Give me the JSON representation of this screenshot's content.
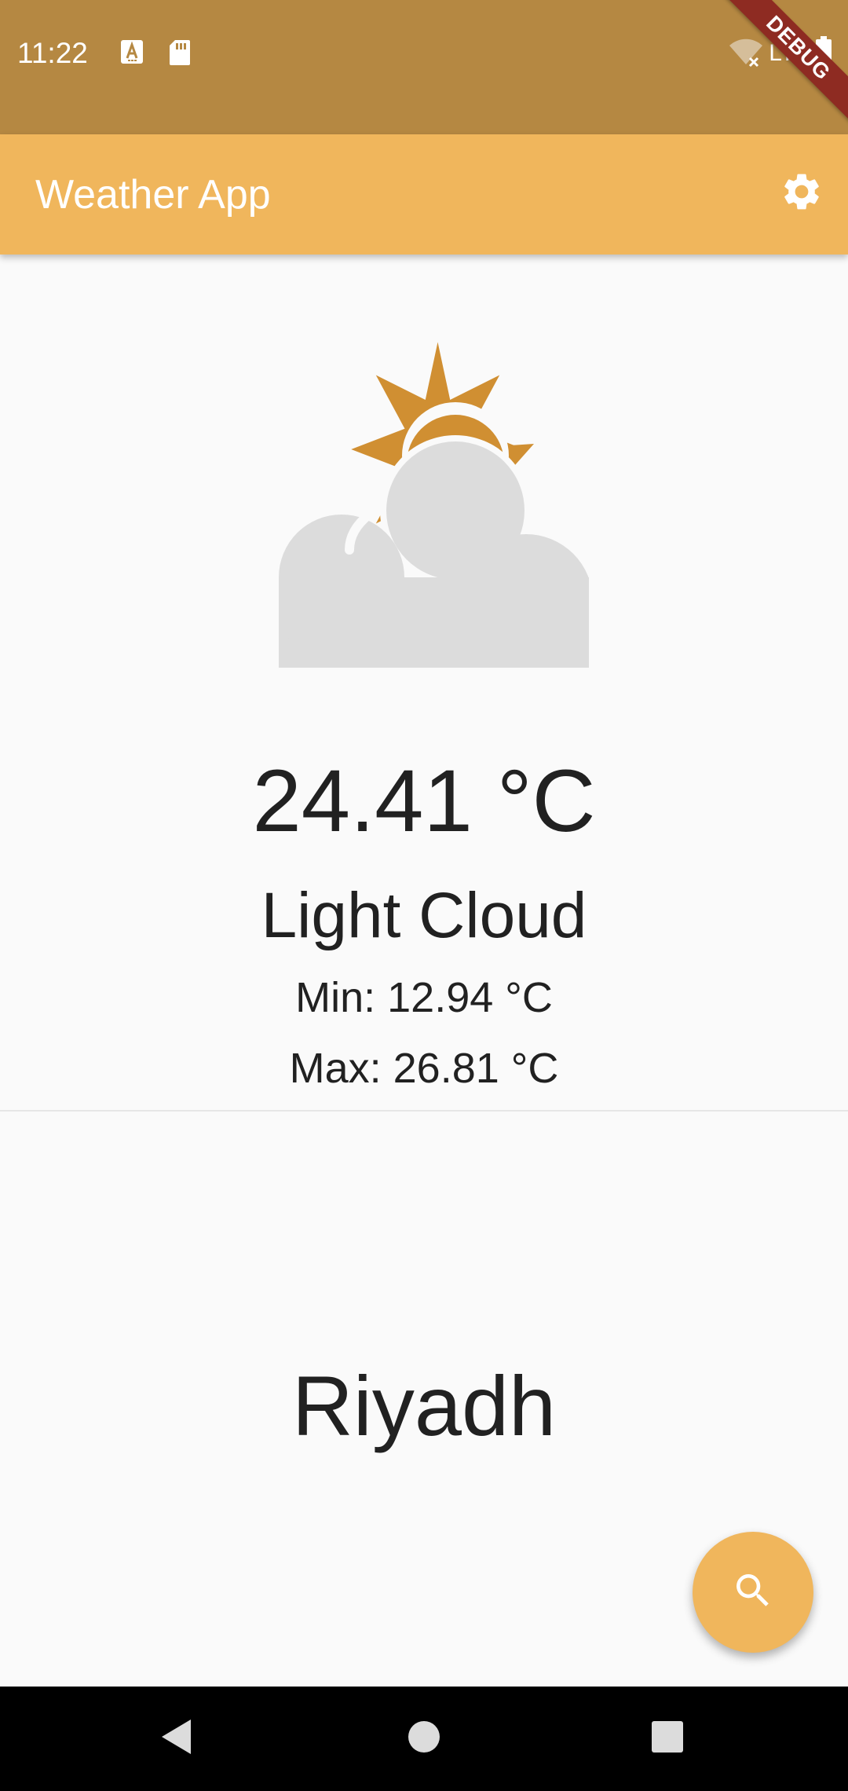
{
  "status_bar": {
    "time": "11:22",
    "network_label": "LTE",
    "debug_label": "DEBUG",
    "icons": [
      "keyboard-a-icon",
      "sd-card-icon",
      "wifi-off-icon",
      "battery-icon"
    ]
  },
  "app_bar": {
    "title": "Weather App",
    "settings_icon": "gear-icon"
  },
  "weather": {
    "icon": "partly-cloudy-icon",
    "temperature": "24.41 °C",
    "condition": "Light Cloud",
    "min": "Min: 12.94 °C",
    "max": "Max: 26.81 °C"
  },
  "location": {
    "city": "Riyadh"
  },
  "fab": {
    "icon": "search-icon"
  },
  "nav_bar": {
    "icons": [
      "back-icon",
      "home-icon",
      "recents-icon"
    ]
  },
  "colors": {
    "status_bar": "#b58842",
    "app_bar": "#f0b65c",
    "sun": "#d08f32",
    "cloud": "#dcdcdc",
    "background": "#fafafa",
    "debug_ribbon": "#8e2b22"
  }
}
